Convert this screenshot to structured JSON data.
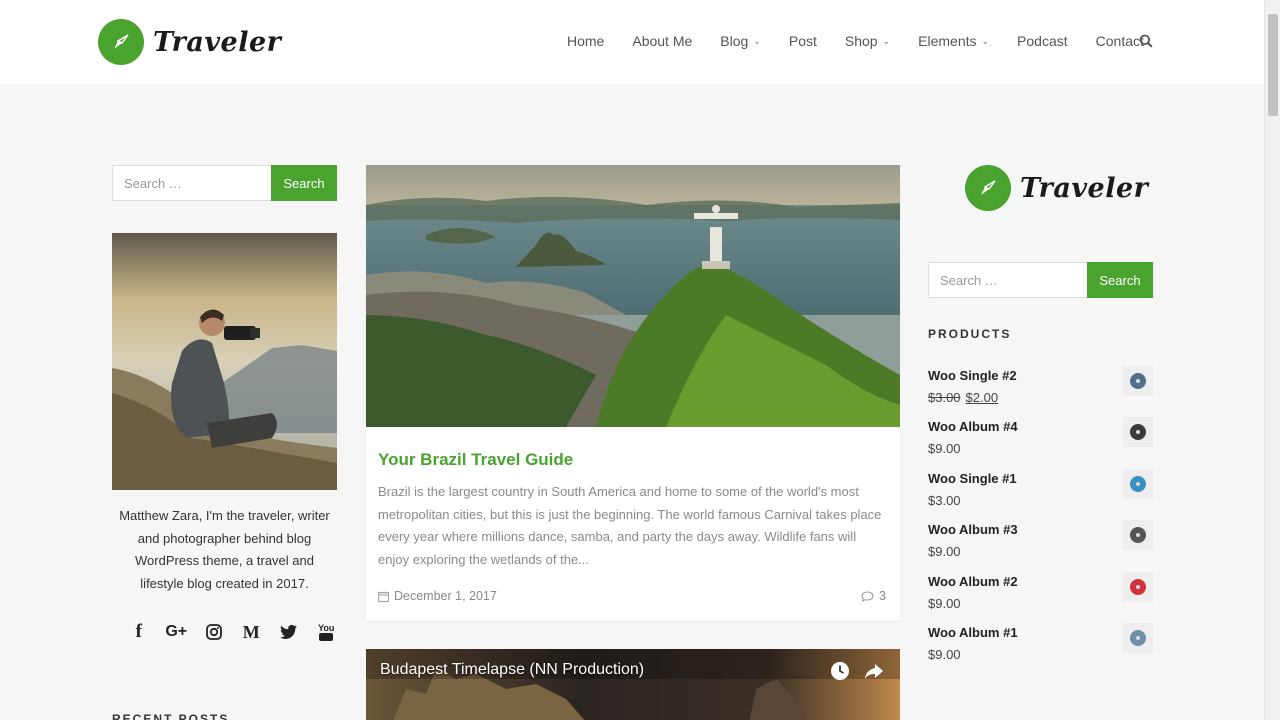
{
  "brand": {
    "name": "Traveler",
    "accent": "#4aa22f"
  },
  "nav": {
    "items": [
      {
        "label": "Home",
        "dropdown": false
      },
      {
        "label": "About Me",
        "dropdown": false
      },
      {
        "label": "Blog",
        "dropdown": true
      },
      {
        "label": "Post",
        "dropdown": false
      },
      {
        "label": "Shop",
        "dropdown": true
      },
      {
        "label": "Elements",
        "dropdown": true
      },
      {
        "label": "Podcast",
        "dropdown": false
      },
      {
        "label": "Contact",
        "dropdown": false
      }
    ],
    "search_icon": "search-icon"
  },
  "left_sidebar": {
    "search": {
      "placeholder": "Search …",
      "button": "Search"
    },
    "bio": "Matthew Zara, I'm the traveler, writer and photographer behind blog WordPress theme, a travel and lifestyle blog created in 2017.",
    "socials": [
      {
        "icon": "facebook-icon",
        "glyph": "f"
      },
      {
        "icon": "google-plus-icon",
        "glyph": "G+"
      },
      {
        "icon": "instagram-icon",
        "glyph": ""
      },
      {
        "icon": "medium-icon",
        "glyph": "M"
      },
      {
        "icon": "twitter-icon",
        "glyph": ""
      },
      {
        "icon": "youtube-icon",
        "glyph": "You"
      }
    ],
    "next_section_title": "RECENT POSTS"
  },
  "post": {
    "title": "Your Brazil Travel Guide",
    "excerpt": "Brazil is the largest country in South America and home to some of the world's most metropolitan cities, but this is just the beginning. The world famous Carnival takes place every year where millions dance, samba, and party the days away. Wildlife fans will enjoy exploring the wetlands of the...",
    "date": "December 1, 2017",
    "comments": "3"
  },
  "video": {
    "title": "Budapest Timelapse (NN Production)"
  },
  "right_sidebar": {
    "search": {
      "placeholder": "Search …",
      "button": "Search"
    },
    "products_title": "PRODUCTS",
    "products": [
      {
        "name": "Woo Single #2",
        "price": "$2.00",
        "old_price": "$3.00",
        "disc_color": "#4f6f8a"
      },
      {
        "name": "Woo Album #4",
        "price": "$9.00",
        "old_price": "",
        "disc_color": "#3a3a3a"
      },
      {
        "name": "Woo Single #1",
        "price": "$3.00",
        "old_price": "",
        "disc_color": "#3b8fc2"
      },
      {
        "name": "Woo Album #3",
        "price": "$9.00",
        "old_price": "",
        "disc_color": "#555555"
      },
      {
        "name": "Woo Album #2",
        "price": "$9.00",
        "old_price": "",
        "disc_color": "#d2333b"
      },
      {
        "name": "Woo Album #1",
        "price": "$9.00",
        "old_price": "",
        "disc_color": "#6d8fa8"
      }
    ]
  }
}
